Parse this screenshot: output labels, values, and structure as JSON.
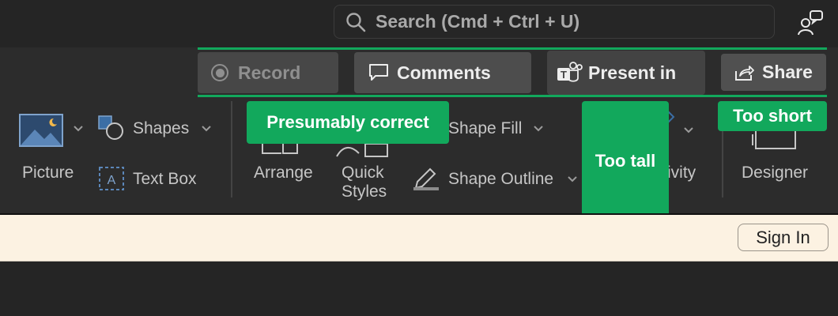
{
  "search": {
    "placeholder": "Search (Cmd + Ctrl + U)"
  },
  "header_buttons": {
    "record": "Record",
    "comments": "Comments",
    "present": "Present in",
    "share": "Share"
  },
  "ribbon": {
    "picture": "Picture",
    "shapes": "Shapes",
    "text_box": "Text Box",
    "arrange": "Arrange",
    "quick_styles": [
      "Quick",
      "Styles"
    ],
    "shape_fill": "Shape Fill",
    "shape_outline": "Shape Outline",
    "creativity_partial": "ivity",
    "designer": "Designer"
  },
  "annotations": {
    "presumably_correct": "Presumably correct",
    "too_tall": "Too tall",
    "too_short": "Too short"
  },
  "signin": {
    "button": "Sign In"
  },
  "colors": {
    "accent_green": "#12a85c",
    "toolbar": "#2c2c2c",
    "banner": "#fcf2e2"
  }
}
